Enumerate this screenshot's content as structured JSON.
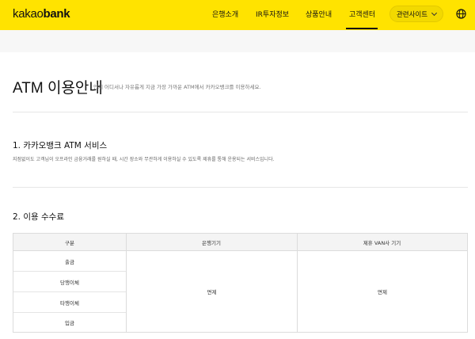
{
  "header": {
    "logo_light": "kakao",
    "logo_bold": "bank",
    "nav": [
      "은행소개",
      "IR투자정보",
      "상품안내",
      "고객센터"
    ],
    "related_sites_label": "관련사이트"
  },
  "page": {
    "title": "ATM 이용안내",
    "subtitle": "언제 어디서나 자유롭게 지금 가장 가까운 ATM에서 카카오뱅크를 이용하세요."
  },
  "section1": {
    "title": "1. 카카오뱅크 ATM 서비스",
    "description": "지점없이도 고객님이 오프라인 금융거래를 원하실 때, 시간 장소와 무관하게 이용하실 수 있도록 제휴를 통해 운용되는 서비스입니다."
  },
  "section2": {
    "title": "2. 이용 수수료",
    "table": {
      "headers": [
        "구분",
        "은행기기",
        "제휴 VAN사 기기"
      ],
      "rows": [
        "출금",
        "당행이체",
        "타행이체",
        "입금"
      ],
      "bank_fee": "면제",
      "van_fee": "면제"
    }
  }
}
